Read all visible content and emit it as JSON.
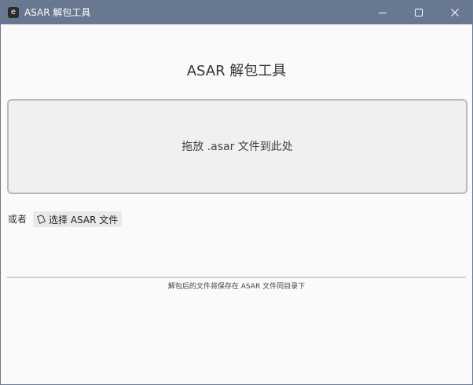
{
  "window": {
    "title": "ASAR 解包工具",
    "app_icon_glyph": "e",
    "controls": {
      "minimize_icon": "minimize-icon",
      "maximize_icon": "maximize-icon",
      "close_icon": "close-icon"
    }
  },
  "main": {
    "heading": "ASAR 解包工具",
    "dropzone_text": "拖放 .asar 文件到此处",
    "or_label": "或者",
    "select_button_label": "选择 ASAR 文件",
    "select_button_icon": "file-icon",
    "hint_text": "解包后的文件将保存在 ASAR 文件同目录下"
  },
  "colors": {
    "titlebar": "#677890",
    "background": "#fafafa",
    "dropzone_bg": "#f0f0f0",
    "dropzone_border": "#b9b9b9",
    "button_bg": "#e9e9e9"
  }
}
